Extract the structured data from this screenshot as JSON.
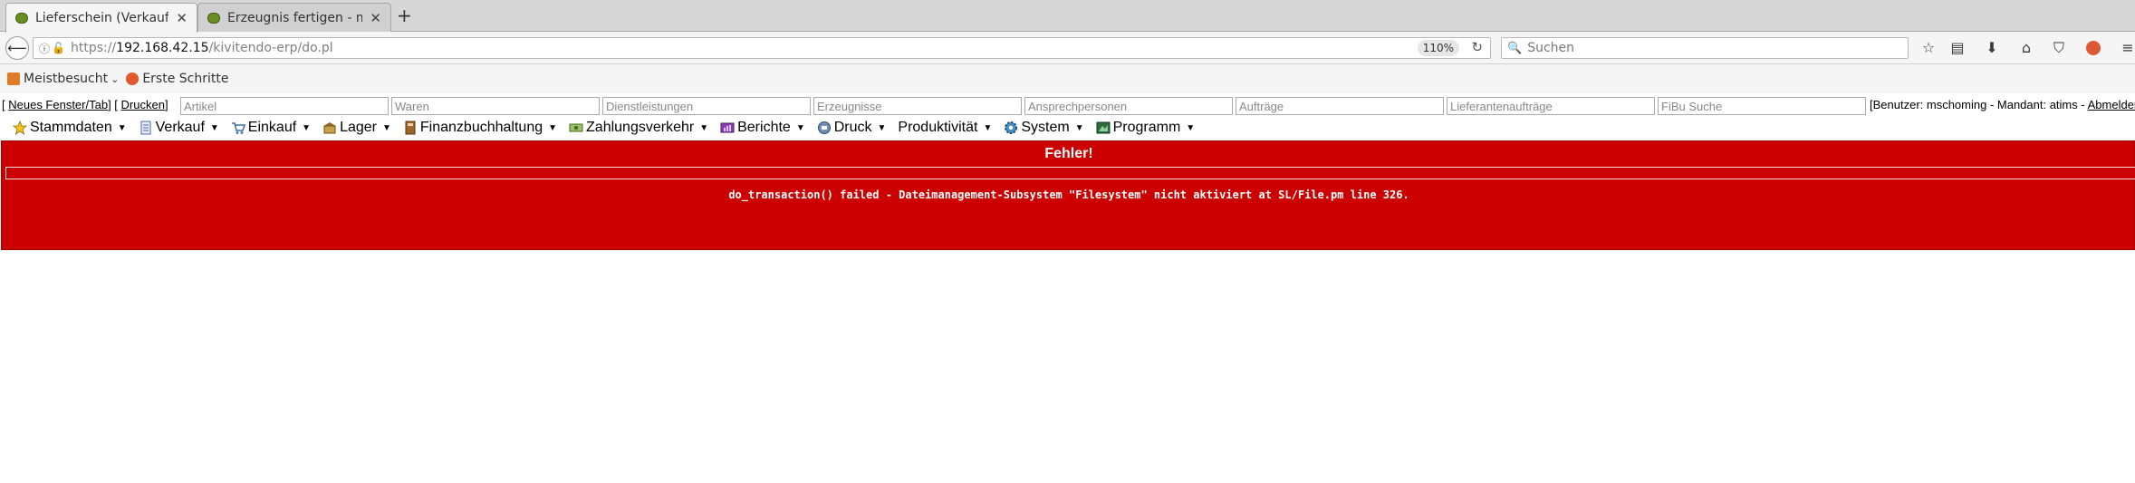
{
  "browser": {
    "tabs": [
      {
        "title": "Lieferschein (Verkauf)",
        "active": true
      },
      {
        "title": "Erzeugnis fertigen - m",
        "active": false
      }
    ],
    "newtab_symbol": "+",
    "url": {
      "proto": "https://",
      "host": "192.168.42.15",
      "path": "/kivitendo-erp/do.pl"
    },
    "zoom": "110%",
    "search_placeholder": "Suchen",
    "bookmarks": [
      {
        "label": "Meistbesucht",
        "icon": "rss-icon",
        "color": "#e07b25"
      },
      {
        "label": "Erste Schritte",
        "icon": "firefox-icon",
        "color": "#e0582b"
      }
    ]
  },
  "quickbar": {
    "new_window": "Neues Fenster/Tab",
    "print": "Drucken",
    "search_fields": [
      "Artikel",
      "Waren",
      "Dienstleistungen",
      "Erzeugnisse",
      "Ansprechpersonen",
      "Aufträge",
      "Lieferantenaufträge",
      "FiBu Suche"
    ],
    "user_text": "[Benutzer: mschoming - Mandant: atims - ",
    "logout": "Abmelden"
  },
  "menu": [
    {
      "label": "Stammdaten",
      "icon": "star-icon"
    },
    {
      "label": "Verkauf",
      "icon": "document-icon"
    },
    {
      "label": "Einkauf",
      "icon": "cart-icon"
    },
    {
      "label": "Lager",
      "icon": "warehouse-icon"
    },
    {
      "label": "Finanzbuchhaltung",
      "icon": "ledger-icon"
    },
    {
      "label": "Zahlungsverkehr",
      "icon": "money-icon"
    },
    {
      "label": "Berichte",
      "icon": "report-icon"
    },
    {
      "label": "Druck",
      "icon": "printer-icon"
    },
    {
      "label": "Produktivität",
      "icon": ""
    },
    {
      "label": "System",
      "icon": "gear-icon"
    },
    {
      "label": "Programm",
      "icon": "program-icon"
    }
  ],
  "error": {
    "title": "Fehler!",
    "message": "do_transaction() failed - Dateimanagement-Subsystem \"Filesystem\" nicht aktiviert at SL/File.pm line 326."
  },
  "colors": {
    "error_bg": "#cc0000",
    "error_text": "#ffffff"
  }
}
